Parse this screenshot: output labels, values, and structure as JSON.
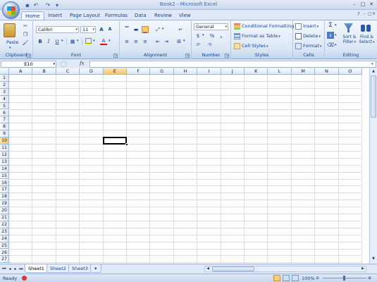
{
  "window": {
    "title": "Book2 - Microsoft Excel"
  },
  "tabs": [
    "Home",
    "Insert",
    "Page Layout",
    "Formulas",
    "Data",
    "Review",
    "View"
  ],
  "ribbon": {
    "clipboard": {
      "label": "Clipboard",
      "paste": "Paste"
    },
    "font": {
      "label": "Font",
      "name": "Calibri",
      "size": "11"
    },
    "alignment": {
      "label": "Alignment"
    },
    "number": {
      "label": "Number",
      "format": "General",
      "currency": "$",
      "percent": "%",
      "comma": ","
    },
    "styles": {
      "label": "Styles",
      "conditional": "Conditional Formatting",
      "table": "Format as Table",
      "cell_styles": "Cell Styles"
    },
    "cells": {
      "label": "Cells",
      "insert": "Insert",
      "delete": "Delete",
      "format": "Format"
    },
    "editing": {
      "label": "Editing",
      "sort": "Sort &",
      "sort2": "Filter",
      "find": "Find &",
      "find2": "Select",
      "sigma": "Σ"
    }
  },
  "formula_bar": {
    "name_box": "E10",
    "fx": "fx",
    "value": ""
  },
  "grid": {
    "columns": [
      "A",
      "B",
      "C",
      "D",
      "E",
      "F",
      "G",
      "H",
      "I",
      "J",
      "K",
      "L",
      "M",
      "N",
      "O"
    ],
    "rows": [
      "1",
      "2",
      "3",
      "4",
      "5",
      "6",
      "7",
      "8",
      "9",
      "10",
      "11",
      "12",
      "13",
      "14",
      "15",
      "16",
      "17",
      "18",
      "19",
      "20",
      "21",
      "22",
      "23",
      "24",
      "25",
      "26",
      "27"
    ],
    "selected_column": "E",
    "selected_row": "10"
  },
  "sheets": [
    "Sheet1",
    "Sheet2",
    "Sheet3"
  ],
  "active_sheet": "Sheet1",
  "status": {
    "ready": "Ready",
    "zoom": "100%"
  },
  "colors": {
    "accent": "#15428b",
    "selection": "#f8c66c",
    "grid_line": "#dadcdd"
  }
}
